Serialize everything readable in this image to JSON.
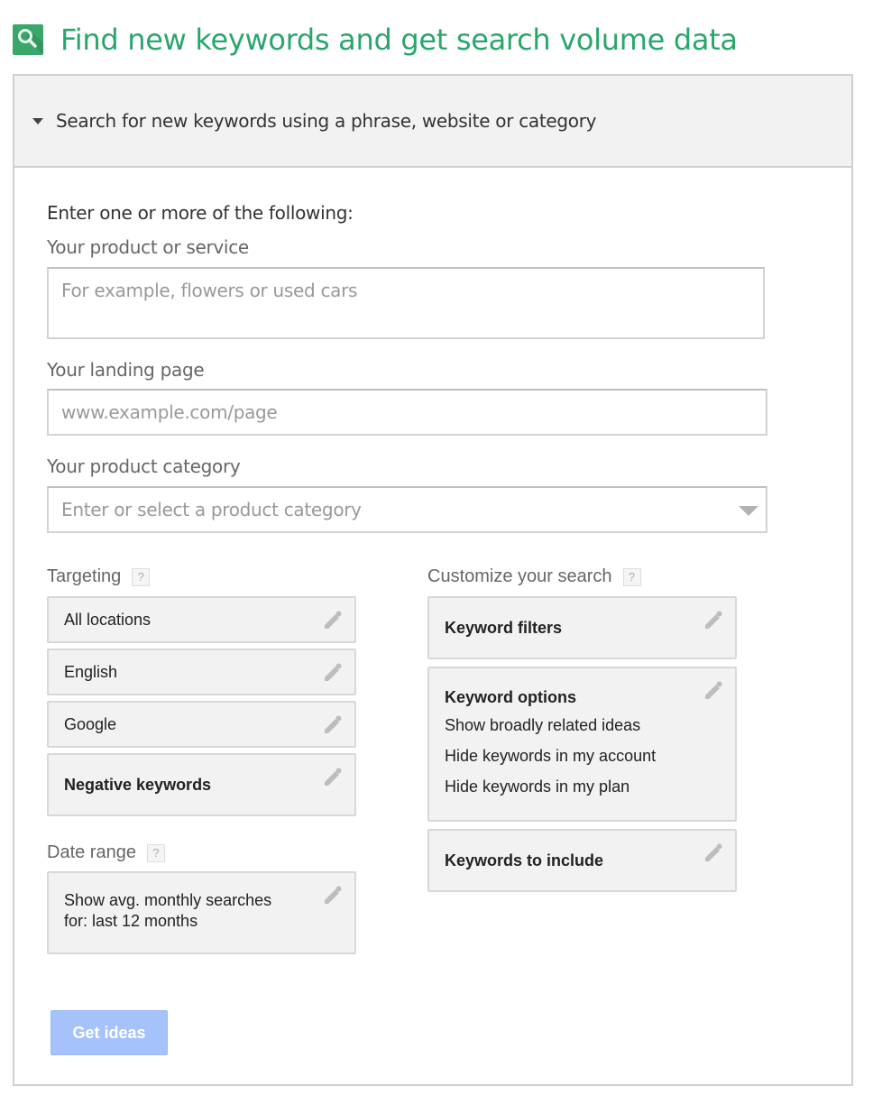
{
  "header": {
    "icon": "search-icon",
    "title": "Find new keywords and get search volume data",
    "accent_color": "#2aa66b"
  },
  "panel": {
    "heading": "Search for new keywords using a phrase, website or category",
    "expanded": true,
    "intro": "Enter one or more of the following:",
    "product": {
      "label": "Your product or service",
      "value": "",
      "placeholder": "For example, flowers or used cars"
    },
    "landing": {
      "label": "Your landing page",
      "value": "",
      "placeholder": "www.example.com/page"
    },
    "category": {
      "label": "Your product category",
      "value": "",
      "placeholder": "Enter or select a product category"
    },
    "targeting": {
      "label": "Targeting",
      "help": "?",
      "items": [
        {
          "label": "All locations",
          "bold": false
        },
        {
          "label": "English",
          "bold": false
        },
        {
          "label": "Google",
          "bold": false
        },
        {
          "label": "Negative keywords",
          "bold": true
        }
      ]
    },
    "date_range": {
      "label": "Date range",
      "help": "?",
      "line1": "Show avg. monthly searches",
      "line2": "for: last 12 months"
    },
    "customize": {
      "label": "Customize your search",
      "help": "?",
      "filters": {
        "title": "Keyword filters"
      },
      "options": {
        "title": "Keyword options",
        "lines": [
          "Show broadly related ideas",
          "Hide keywords in my account",
          "Hide keywords in my plan"
        ]
      },
      "include": {
        "title": "Keywords to include"
      }
    },
    "get_ideas": {
      "label": "Get ideas",
      "enabled": false,
      "color": "#a6c2fb"
    }
  }
}
